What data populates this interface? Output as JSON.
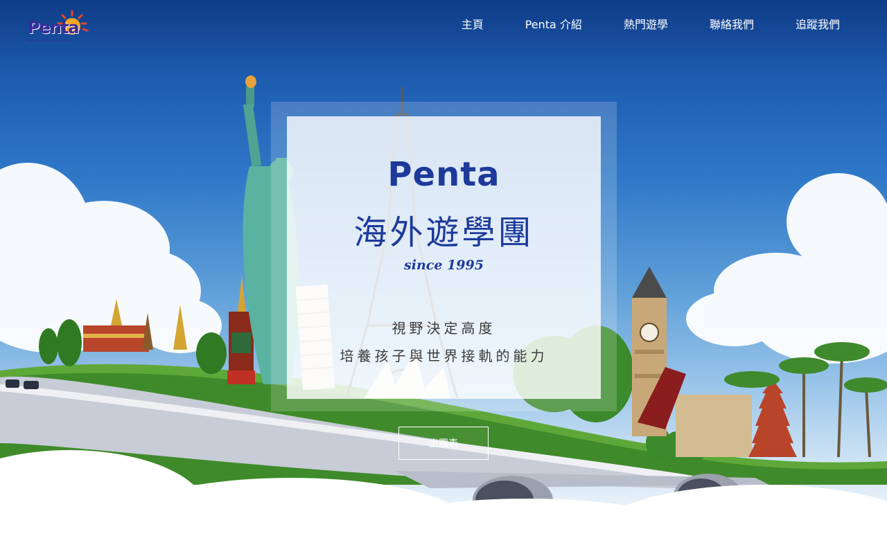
{
  "logo": {
    "text": "Penta",
    "subtitle": "International Educational Tours",
    "icon": "sun-logo-icon",
    "colors": {
      "text": "#3a2a9a",
      "sun": "#f5a623"
    }
  },
  "nav": {
    "items": [
      {
        "label": "主頁"
      },
      {
        "label": "Penta 介紹"
      },
      {
        "label": "熱門遊學"
      },
      {
        "label": "聯絡我們"
      },
      {
        "label": "追蹤我們"
      }
    ]
  },
  "hero": {
    "brand": "Penta",
    "headline": "海外遊學團",
    "since": "since 1995",
    "slogan_line1": "視野決定高度",
    "slogan_line2": "培養孩子與世界接軌的能力",
    "cta_label": "出團表",
    "accent_color": "#1d3a9a"
  }
}
